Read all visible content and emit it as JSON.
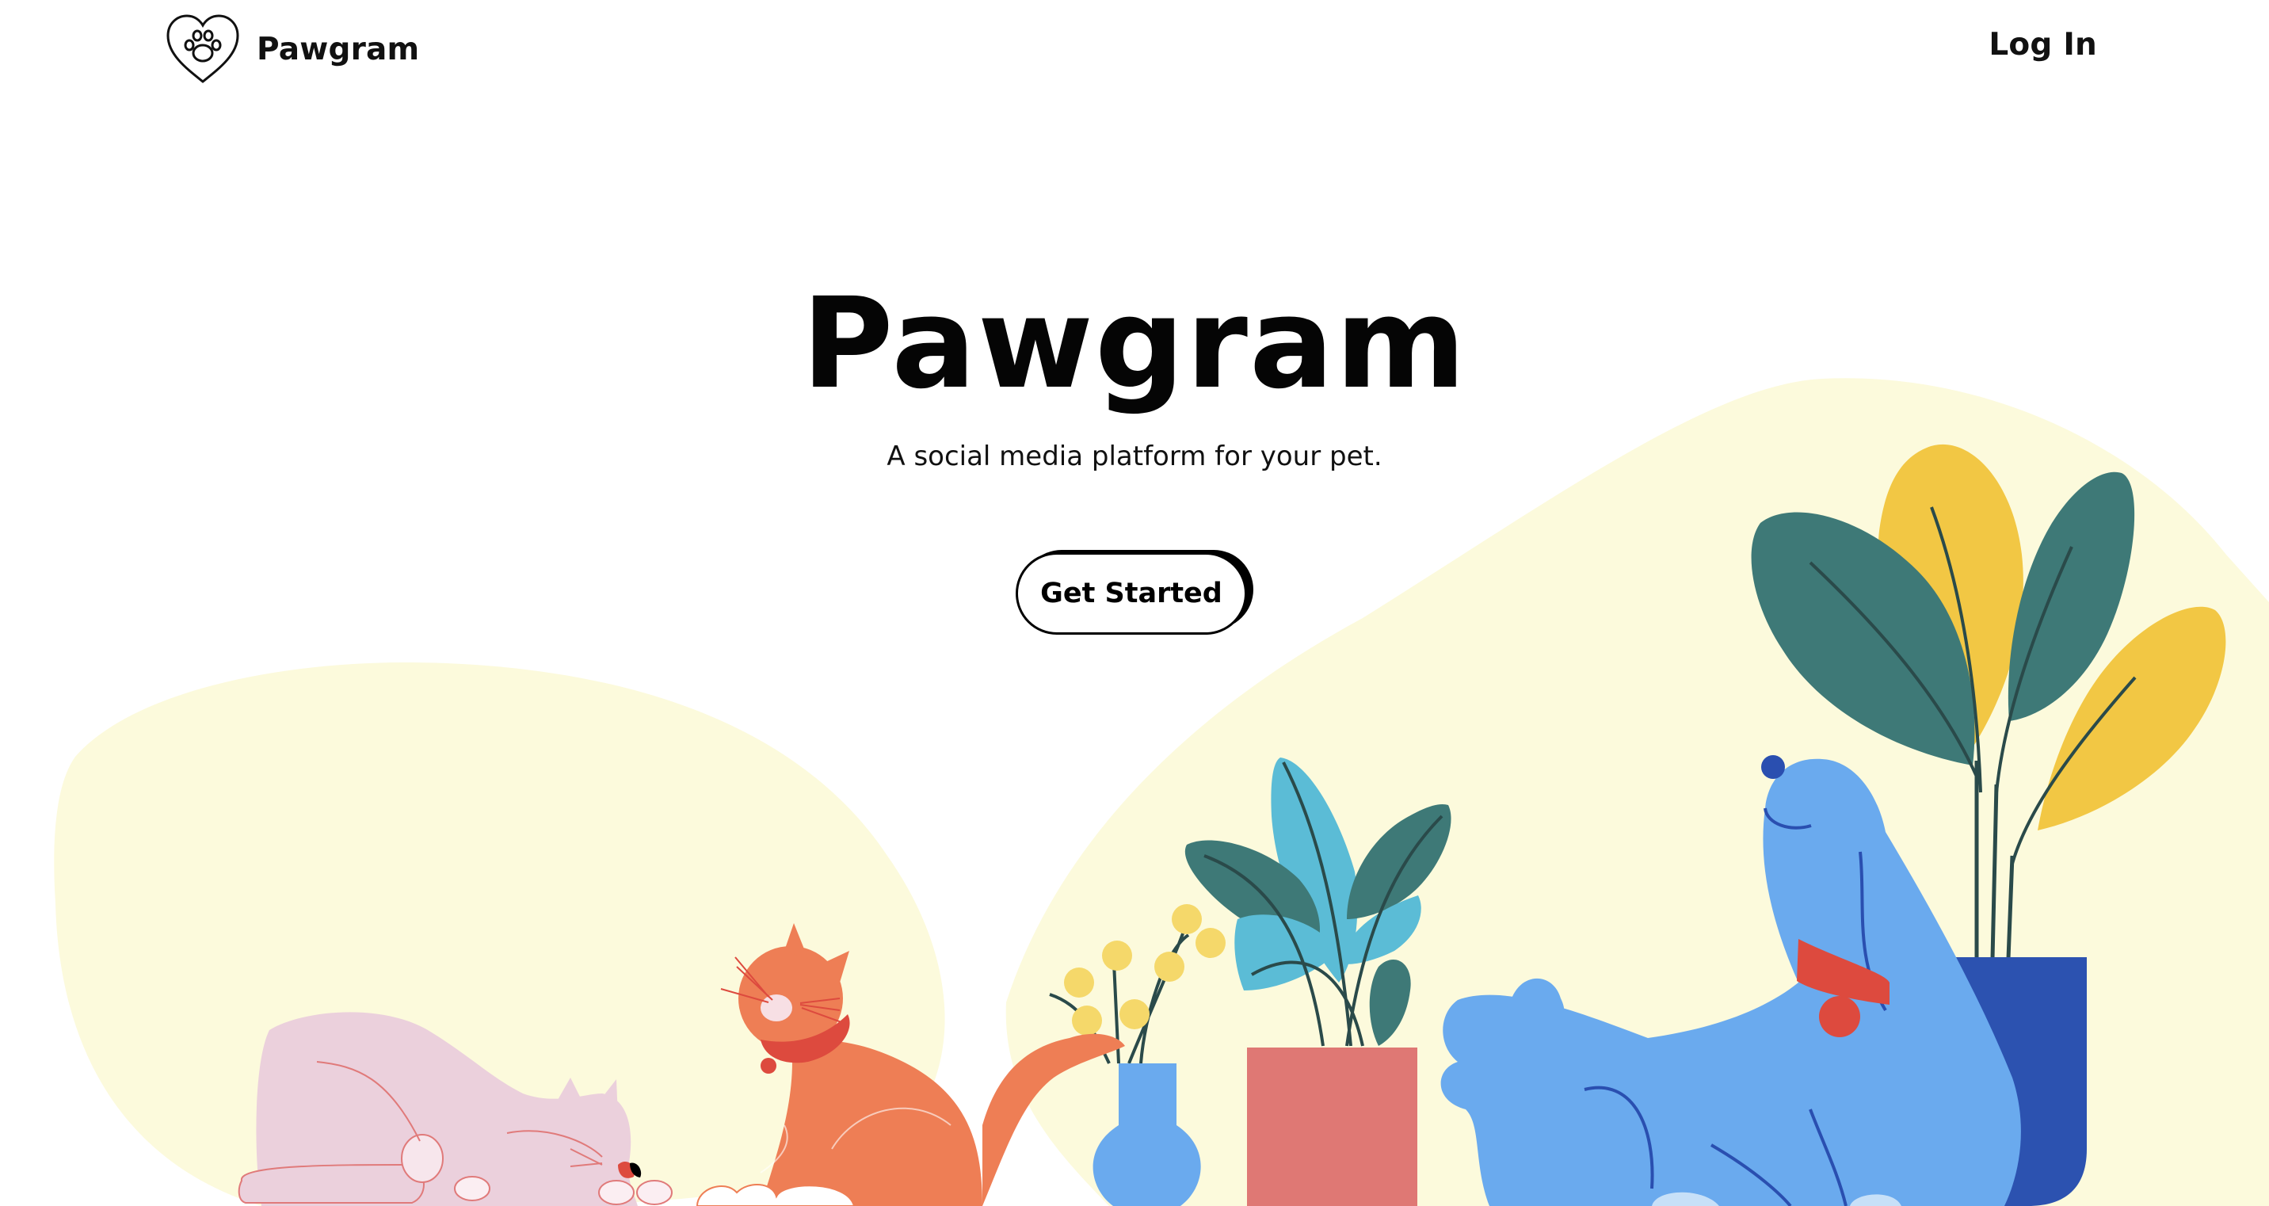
{
  "header": {
    "brand_name": "Pawgram",
    "login_label": "Log In"
  },
  "hero": {
    "title": "Pawgram",
    "subtitle": "A social media platform for your pet.",
    "cta_label": "Get Started"
  },
  "colors": {
    "blob": "#fcfadc",
    "text": "#111111",
    "dog": "#6aaaee",
    "dog_dark": "#2a4fb0",
    "collar": "#dd4a3e",
    "cat_orange": "#ee7e55",
    "cat_pink": "#ebd0dc",
    "leaf_teal": "#3e7977",
    "leaf_yellow": "#f2c744",
    "leaf_blue": "#5bbcd6",
    "pot_red": "#df7874",
    "pot_blue": "#2c52b0"
  },
  "icons": {
    "brand": "heart-paw-icon"
  }
}
